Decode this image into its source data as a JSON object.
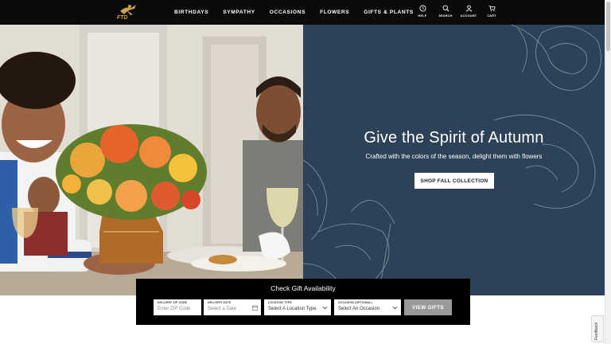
{
  "header": {
    "logo_text": "FTD",
    "nav": [
      "BIRTHDAYS",
      "SYMPATHY",
      "OCCASIONS",
      "FLOWERS",
      "GIFTS & PLANTS"
    ],
    "utilities": {
      "help": {
        "label": "HELP",
        "icon": "help-circle-icon"
      },
      "search": {
        "label": "SEARCH",
        "icon": "search-icon"
      },
      "account": {
        "label": "ACCOUNT",
        "icon": "user-icon"
      },
      "cart": {
        "label": "CART",
        "icon": "cart-icon"
      }
    }
  },
  "hero": {
    "headline": "Give the Spirit of Autumn",
    "subhead": "Crafted with the colors of the season, delight them with flowers",
    "cta": "SHOP FALL COLLECTION"
  },
  "gift_check": {
    "title": "Check Gift Availability",
    "delivery_zip": {
      "caption": "DELIVERY ZIP CODE",
      "placeholder": "Enter ZIP Code"
    },
    "delivery_date": {
      "caption": "DELIVERY DATE",
      "placeholder": "Select a Date"
    },
    "location_type": {
      "caption": "LOCATION TYPE",
      "value": "Select A Location Type"
    },
    "occasion": {
      "caption": "OCCASION (OPTIONAL)",
      "value": "Select An Occasion"
    },
    "button": "VIEW GIFTS"
  },
  "feedback": {
    "label": "Feedback"
  },
  "colors": {
    "header_bg": "#0b0b0b",
    "hero_panel": "#2d4257",
    "logo_gold": "#c9a24a",
    "button_gray": "#9a9a9a"
  }
}
